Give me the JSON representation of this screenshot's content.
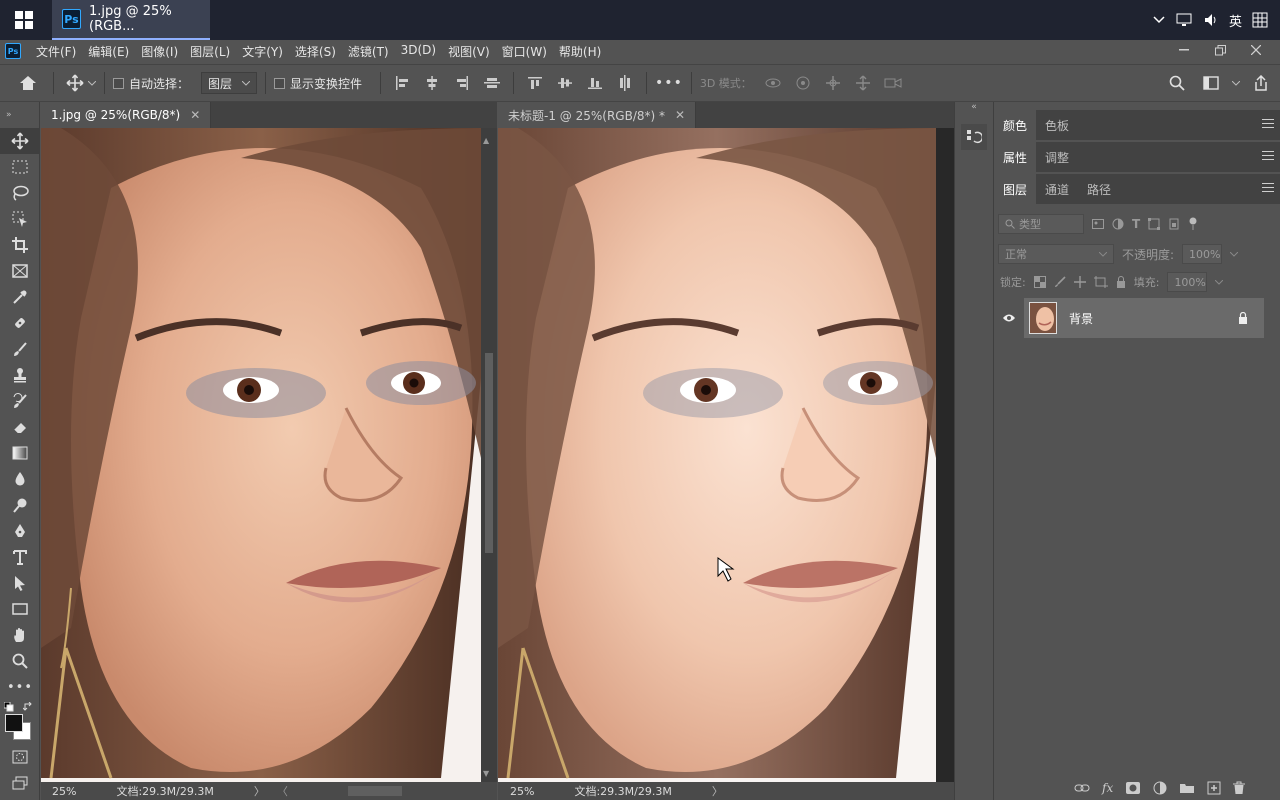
{
  "taskbar": {
    "app_tab_title": "1.jpg @ 25%(RGB...",
    "ps_logo": "Ps",
    "ime": "英"
  },
  "menubar": {
    "items": [
      "文件(F)",
      "编辑(E)",
      "图像(I)",
      "图层(L)",
      "文字(Y)",
      "选择(S)",
      "滤镜(T)",
      "3D(D)",
      "视图(V)",
      "窗口(W)",
      "帮助(H)"
    ]
  },
  "options": {
    "auto_select_label": "自动选择：",
    "auto_select_value": "图层",
    "show_transform_label": "显示变换控件",
    "more": "•••",
    "mode_3d_label": "3D 模式："
  },
  "documents": [
    {
      "tab_title": "1.jpg @ 25%(RGB/8*)",
      "zoom": "25%",
      "doc_info": "文档:29.3M/29.3M"
    },
    {
      "tab_title": "未标题-1 @ 25%(RGB/8*) *",
      "zoom": "25%",
      "doc_info": "文档:29.3M/29.3M"
    }
  ],
  "panels": {
    "group1_tabs": [
      "颜色",
      "色板"
    ],
    "group2_tabs": [
      "属性",
      "调整"
    ],
    "group3_tabs": [
      "图层",
      "通道",
      "路径"
    ],
    "filter_placeholder": "类型",
    "blend_mode": "正常",
    "opacity_label": "不透明度:",
    "opacity_value": "100%",
    "lock_label": "锁定:",
    "fill_label": "填充:",
    "fill_value": "100%",
    "layer_name": "背景"
  },
  "colors": {
    "ps_blue": "#31a8ff",
    "panel_bg": "#535353",
    "tab_bg": "#424242"
  }
}
